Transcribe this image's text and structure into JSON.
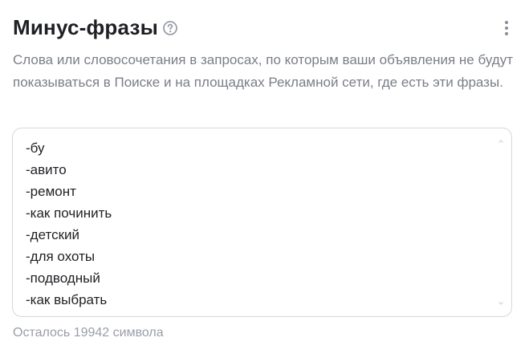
{
  "section": {
    "title": "Минус-фразы",
    "help_icon": "question-circle-icon",
    "more_icon": "more-vertical-icon",
    "description": "Слова или словосочетания в запросах, по которым ваши объявления не будут показываться в Поиске и на площадках Рекламной сети, где есть эти фразы."
  },
  "phrases": [
    "-бу",
    "-авито",
    "-ремонт",
    "-как починить",
    "-детский",
    "-для охоты",
    "-подводный",
    "-как выбрать"
  ],
  "counter_text": "Осталось 19942 символа",
  "colors": {
    "title": "#1f2024",
    "secondary_text": "#7a7e88",
    "counter_text": "#9a9ea8",
    "border": "#d6d8dd"
  }
}
